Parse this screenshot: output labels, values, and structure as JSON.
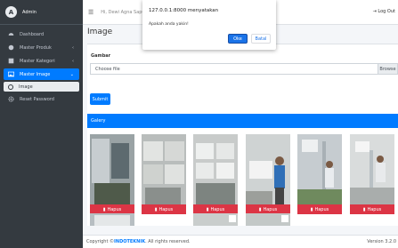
{
  "sidebar": {
    "brand": "Admin",
    "items": [
      {
        "label": "Dashboard",
        "icon": "dashboard-icon"
      },
      {
        "label": "Master Produk",
        "icon": "box-icon"
      },
      {
        "label": "Master Kategori",
        "icon": "list-icon"
      },
      {
        "label": "Master Image",
        "icon": "image-icon"
      },
      {
        "label": "Image",
        "icon": "circle-icon"
      },
      {
        "label": "Reset Password",
        "icon": "gear-icon"
      }
    ]
  },
  "topbar": {
    "greeting": "Hi, Dewi Agna Saputri",
    "logout": "Log Out"
  },
  "page": {
    "title": "Image"
  },
  "form": {
    "label": "Gambar",
    "file_placeholder": "Choose file",
    "browse": "Browse",
    "submit": "Submit"
  },
  "gallery": {
    "title": "Galery",
    "delete_label": "Hapus"
  },
  "footer": {
    "prefix": "Copyright © ",
    "brand": "INDOTEKNIK",
    "suffix": ". All rights reserved.",
    "version": "Version 3.2.0"
  },
  "dialog": {
    "title": "127.0.0.1:8000 menyatakan",
    "message": "Apakah anda yakin!",
    "ok": "Oke",
    "cancel": "Batal"
  },
  "colors": {
    "primary": "#007bff",
    "danger": "#dc3545",
    "sidebar": "#343a40"
  }
}
